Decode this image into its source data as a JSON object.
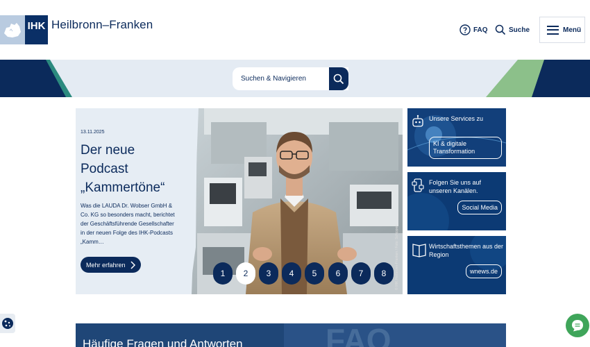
{
  "header": {
    "logo_text": "IHK",
    "org_name": "Heilbronn–Franken",
    "faq_label": "FAQ",
    "search_label": "Suche",
    "menu_label": "Menü"
  },
  "search": {
    "placeholder": "Suchen & Navigieren"
  },
  "hero": {
    "date": "13.11.2025",
    "title_line1": "Der neue",
    "title_line2": "Podcast",
    "title_line3": "„Kammertöne“",
    "description": "Was die LAUDA Dr. Wobser GmbH & Co. KG so besonders macht, berichtet der Geschäftsführende Gesellschafter in der neuen Folge des IHK-Podcasts „Kamm…",
    "more_label": "Mehr erfahren",
    "photo_credit": "© IHK Heilbronn-Franken / Foto: Schippert",
    "pages": [
      "1",
      "2",
      "3",
      "4",
      "5",
      "6",
      "7",
      "8"
    ],
    "active_page": "2"
  },
  "cards": [
    {
      "title": "Unsere Services zu",
      "button": "KI & digitale Transformation",
      "icon": "robot-icon"
    },
    {
      "title": "Folgen Sie uns auf unseren Kanälen.",
      "button": "Social Media",
      "icon": "social-media-icon"
    },
    {
      "title": "Wirtschaftsthemen aus der Region",
      "button": "wnews.de",
      "icon": "book-icon"
    }
  ],
  "faq_section": {
    "title": "Häufige Fragen und Antworten"
  },
  "colors": {
    "navy": "#0b2a5b",
    "light_blue_bg": "#e4ebf3",
    "green_accent": "#3fa55a",
    "teal_accent": "#2c8a7f"
  }
}
